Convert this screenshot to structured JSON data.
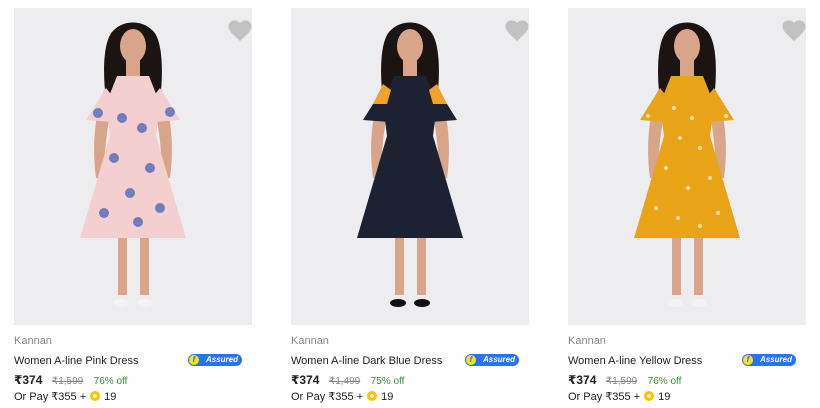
{
  "products": [
    {
      "brand": "Kannan",
      "title": "Women A-line Pink Dress",
      "assured_label": "Assured",
      "price": "₹374",
      "mrp": "₹1,599",
      "discount": "76% off",
      "pay_prefix": "Or Pay ₹355 +",
      "coins": "19",
      "dress_color": "#f4cfcf",
      "pattern_color": "#5b6fb8",
      "pattern": "floral"
    },
    {
      "brand": "Kannan",
      "title": "Women A-line Dark Blue Dress",
      "assured_label": "Assured",
      "price": "₹374",
      "mrp": "₹1,499",
      "discount": "75% off",
      "pay_prefix": "Or Pay ₹355 +",
      "coins": "19",
      "dress_color": "#1d2233",
      "pattern_color": "#f0a22a",
      "pattern": "plain"
    },
    {
      "brand": "Kannan",
      "title": "Women A-line Yellow Dress",
      "assured_label": "Assured",
      "price": "₹374",
      "mrp": "₹1,599",
      "discount": "76% off",
      "pay_prefix": "Or Pay ₹355 +",
      "coins": "19",
      "dress_color": "#e8a317",
      "pattern_color": "#fbe7b0",
      "pattern": "ditsy"
    }
  ],
  "colors": {
    "assured_blue": "#2874f0",
    "discount_green": "#388e3c",
    "muted_text": "#878787",
    "wishlist_heart": "#c2c2c2",
    "coin": "#ffc200"
  }
}
